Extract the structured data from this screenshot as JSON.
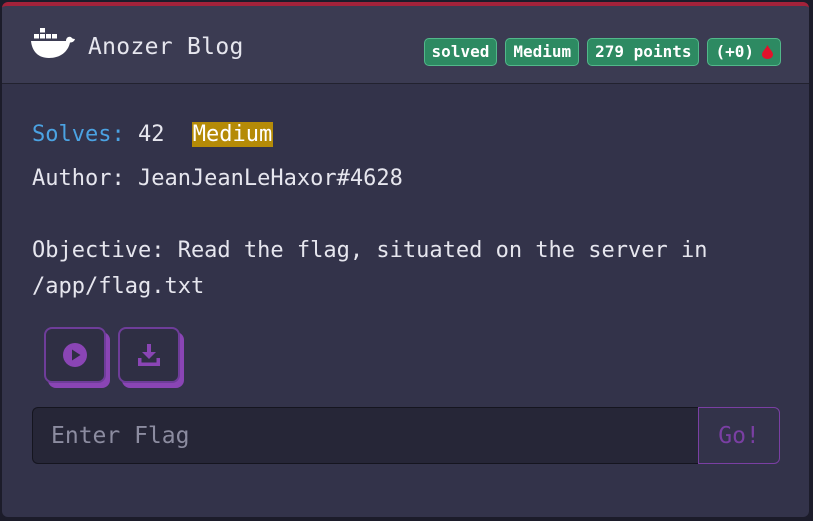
{
  "challenge": {
    "title": "Anozer Blog",
    "icon": "docker-whale-icon",
    "badges": {
      "status": "solved",
      "difficulty": "Medium",
      "points": "279 points",
      "bonus": "(+0)"
    },
    "solves_label": "Solves:",
    "solves_count": "42",
    "difficulty_tag": "Medium",
    "author": "Author: JeanJeanLeHaxor#4628",
    "objective_line1": "Objective: Read the flag, situated on the server in",
    "objective_line2": "/app/flag.txt"
  },
  "actions": {
    "start_icon": "play-circle-icon",
    "download_icon": "download-icon"
  },
  "flag_form": {
    "placeholder": "Enter Flag",
    "submit_label": "Go!"
  },
  "colors": {
    "accent_top": "#a3223a",
    "badge_green": "#2d8a62",
    "solves_blue": "#4ba3e3",
    "medium_gold": "#b58b07",
    "purple": "#8a45b5"
  }
}
